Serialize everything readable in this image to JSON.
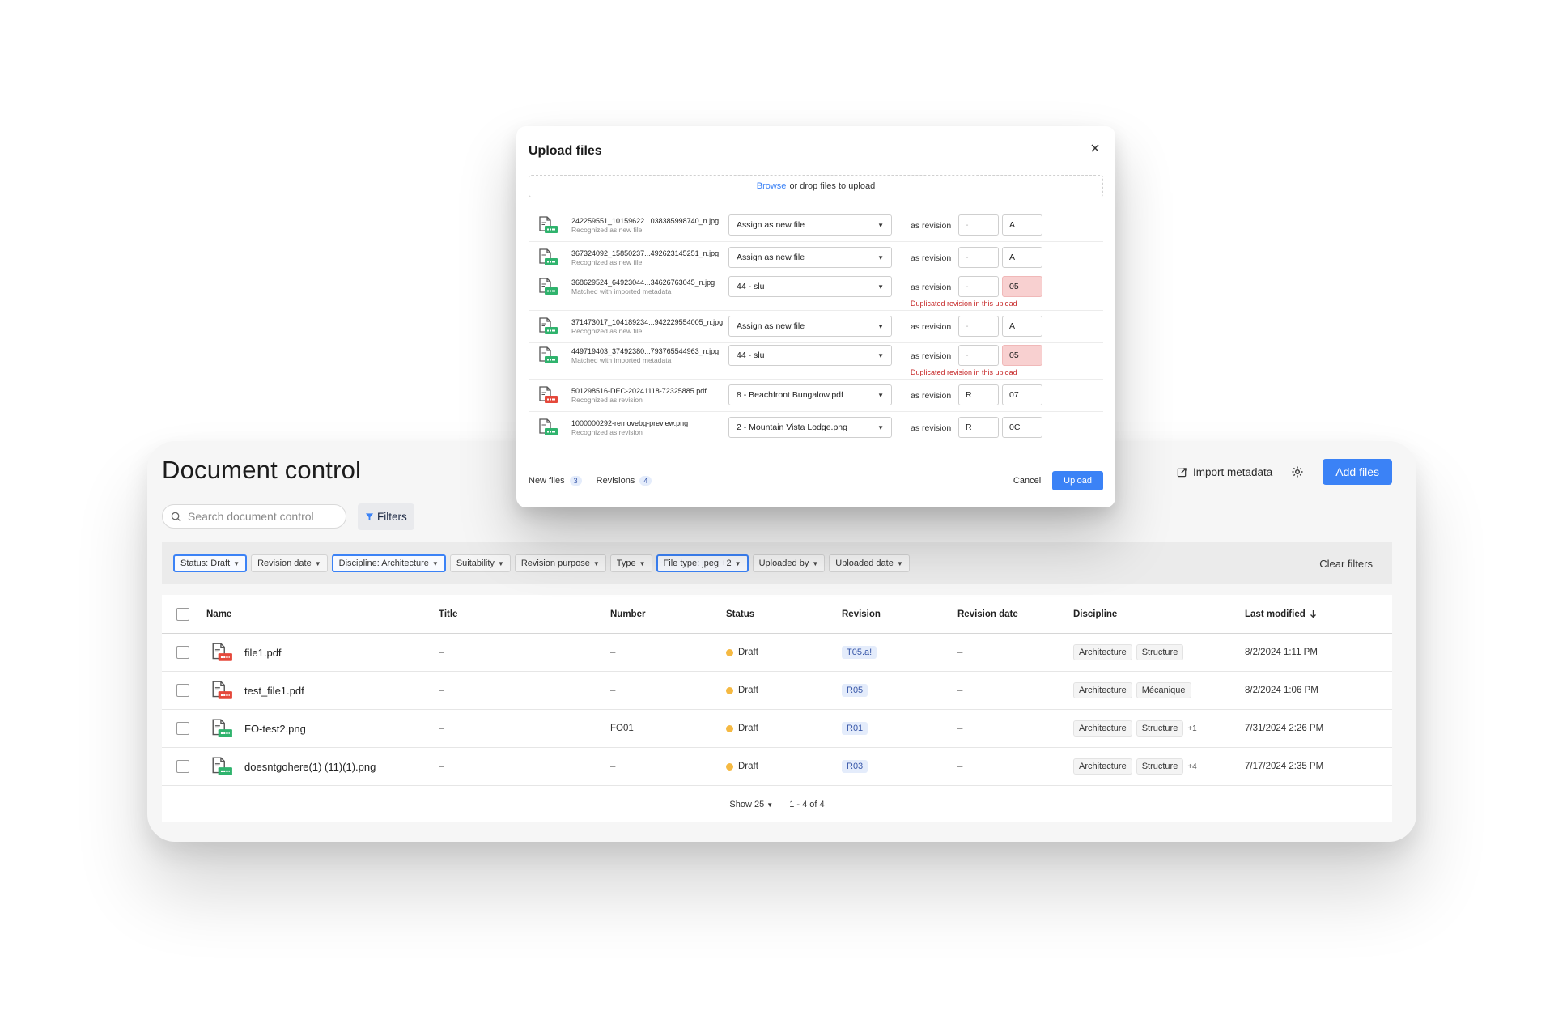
{
  "doc": {
    "title": "Document control",
    "import_label": "Import metadata",
    "add_files_label": "Add files",
    "search_placeholder": "Search document control",
    "filters_label": "Filters",
    "filters": [
      {
        "label": "Status: Draft",
        "active": true
      },
      {
        "label": "Revision date",
        "active": false
      },
      {
        "label": "Discipline: Architecture",
        "active": true
      },
      {
        "label": "Suitability",
        "active": false
      },
      {
        "label": "Revision purpose",
        "active": false
      },
      {
        "label": "Type",
        "active": false
      },
      {
        "label": "File type: jpeg +2",
        "active": true
      },
      {
        "label": "Uploaded by",
        "active": false
      },
      {
        "label": "Uploaded date",
        "active": false
      }
    ],
    "clear_filters_label": "Clear filters",
    "columns": {
      "name": "Name",
      "title": "Title",
      "number": "Number",
      "status": "Status",
      "revision": "Revision",
      "revision_date": "Revision date",
      "discipline": "Discipline",
      "last_modified": "Last modified"
    },
    "rows": [
      {
        "name": "file1.pdf",
        "type": "PDF",
        "title": "–",
        "number": "–",
        "status": "Draft",
        "revision": "T05.a!",
        "revision_date": "–",
        "disciplines": [
          "Architecture",
          "Structure"
        ],
        "extra": "",
        "last_modified": "8/2/2024 1:11 PM"
      },
      {
        "name": "test_file1.pdf",
        "type": "PDF",
        "title": "–",
        "number": "–",
        "status": "Draft",
        "revision": "R05",
        "revision_date": "–",
        "disciplines": [
          "Architecture",
          "Mécanique"
        ],
        "extra": "",
        "last_modified": "8/2/2024 1:06 PM"
      },
      {
        "name": "FO-test2.png",
        "type": "PNG",
        "title": "–",
        "number": "FO01",
        "status": "Draft",
        "revision": "R01",
        "revision_date": "–",
        "disciplines": [
          "Architecture",
          "Structure"
        ],
        "extra": "+1",
        "last_modified": "7/31/2024 2:26 PM"
      },
      {
        "name": "doesntgohere(1) (11)(1).png",
        "type": "PNG",
        "title": "–",
        "number": "–",
        "status": "Draft",
        "revision": "R03",
        "revision_date": "–",
        "disciplines": [
          "Architecture",
          "Structure"
        ],
        "extra": "+4",
        "last_modified": "7/17/2024 2:35 PM"
      }
    ],
    "pagination": {
      "show": "Show 25",
      "range": "1 - 4 of 4"
    }
  },
  "modal": {
    "title": "Upload files",
    "browse": "Browse",
    "drop_text": "or drop files to upload",
    "as_revision": "as revision",
    "files": [
      {
        "name": "242259551_10159622...038385998740_n.jpg",
        "sub": "Recognized as new file",
        "type": "JPG",
        "assign": "Assign as new file",
        "prefix": "-",
        "revision": "A",
        "error": ""
      },
      {
        "name": "367324092_15850237...492623145251_n.jpg",
        "sub": "Recognized as new file",
        "type": "JPG",
        "assign": "Assign as new file",
        "prefix": "-",
        "revision": "A",
        "error": ""
      },
      {
        "name": "368629524_64923044...34626763045_n.jpg",
        "sub": "Matched with imported metadata",
        "type": "JPG",
        "assign": "44 - slu",
        "prefix": "-",
        "revision": "05",
        "error": "Duplicated revision in this upload"
      },
      {
        "name": "371473017_104189234...942229554005_n.jpg",
        "sub": "Recognized as new file",
        "type": "JPG",
        "assign": "Assign as new file",
        "prefix": "-",
        "revision": "A",
        "error": ""
      },
      {
        "name": "449719403_37492380...793765544963_n.jpg",
        "sub": "Matched with imported metadata",
        "type": "JPG",
        "assign": "44 - slu",
        "prefix": "-",
        "revision": "05",
        "error": "Duplicated revision in this upload"
      },
      {
        "name": "501298516-DEC-20241118-72325885.pdf",
        "sub": "Recognized as revision",
        "type": "PDF",
        "assign": "8 - Beachfront Bungalow.pdf",
        "prefix": "R",
        "revision": "07",
        "error": ""
      },
      {
        "name": "1000000292-removebg-preview.png",
        "sub": "Recognized as revision",
        "type": "PNG",
        "assign": "2 - Mountain Vista Lodge.png",
        "prefix": "R",
        "revision": "0C",
        "error": ""
      }
    ],
    "new_files_label": "New files",
    "new_files_count": "3",
    "revisions_label": "Revisions",
    "revisions_count": "4",
    "cancel_label": "Cancel",
    "upload_label": "Upload"
  },
  "colors": {
    "accent": "#3b82f6",
    "pdf": "#e5483b",
    "image": "#2fb36d",
    "draft": "#f5b942",
    "error": "#c62828"
  },
  "icons": {
    "close": "close-icon",
    "search": "search-icon",
    "filter": "filter-icon",
    "gear": "gear-icon",
    "import": "import-icon",
    "chevron": "chevron-down-icon",
    "sort": "sort-arrow-icon",
    "file": "file-type-icon"
  }
}
